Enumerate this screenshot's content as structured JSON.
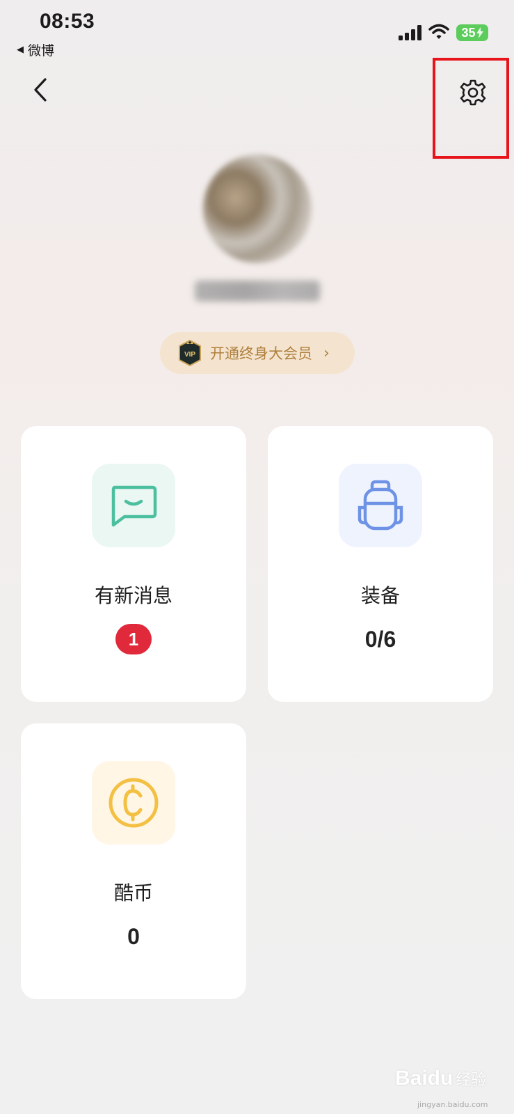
{
  "status_bar": {
    "time": "08:53",
    "back_app": "微博",
    "battery": "35"
  },
  "nav": {
    "back_icon": "chevron-left-icon",
    "settings_icon": "gear-icon",
    "highlight_color": "#e8141c"
  },
  "profile": {
    "vip_badge_text": "VIP",
    "vip_label": "开通终身大会员"
  },
  "cards": [
    {
      "icon": "message-icon",
      "title": "有新消息",
      "badge": "1",
      "icon_bg": "#eaf7f3",
      "icon_color": "#4cbf9f"
    },
    {
      "icon": "backpack-icon",
      "title": "装备",
      "value": "0/6",
      "icon_bg": "#eef3fe",
      "icon_color": "#6e93e6"
    },
    {
      "icon": "coin-icon",
      "title": "酷币",
      "value": "0",
      "icon_bg": "#fff6e6",
      "icon_color": "#f3c043"
    }
  ],
  "watermark": {
    "main": "Baidu",
    "sub": "经验",
    "url": "jingyan.baidu.com"
  }
}
